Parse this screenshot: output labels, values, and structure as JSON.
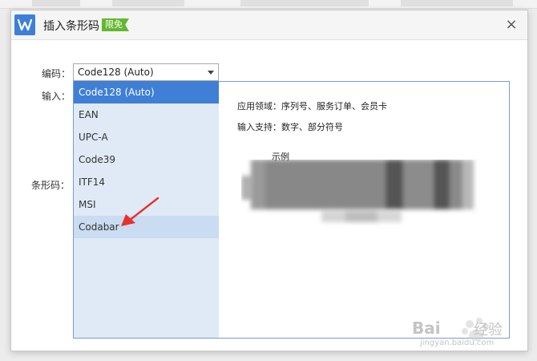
{
  "dialog": {
    "title": "插入条形码",
    "badge": "限免",
    "close_symbol": "×"
  },
  "form": {
    "encoding_label": "编码：",
    "input_label": "输入：",
    "barcode_label": "条形码：",
    "selected_encoding": "Code128 (Auto)"
  },
  "dropdown": {
    "options": [
      "Code128 (Auto)",
      "EAN",
      "UPC-A",
      "Code39",
      "ITF14",
      "MSI",
      "Codabar"
    ],
    "selected_index": 0,
    "hover_index": 6
  },
  "info": {
    "application": "应用领域：序列号、服务订单、会员卡",
    "input_support": "输入支持：数字、部分符号",
    "example_label": "示例"
  },
  "watermark": {
    "brand": "Bai",
    "brand_suffix": "经验",
    "url": "jingyan.baidu.com"
  },
  "colors": {
    "accent": "#3f7fd6",
    "badge": "#63b82f",
    "list_bg": "#dfeaf6",
    "arrow": "#e8302c"
  },
  "icons": {
    "app_logo": "wps-w-logo-icon",
    "close": "close-icon",
    "dropdown": "chevron-down-icon",
    "pointer": "red-arrow-icon"
  }
}
